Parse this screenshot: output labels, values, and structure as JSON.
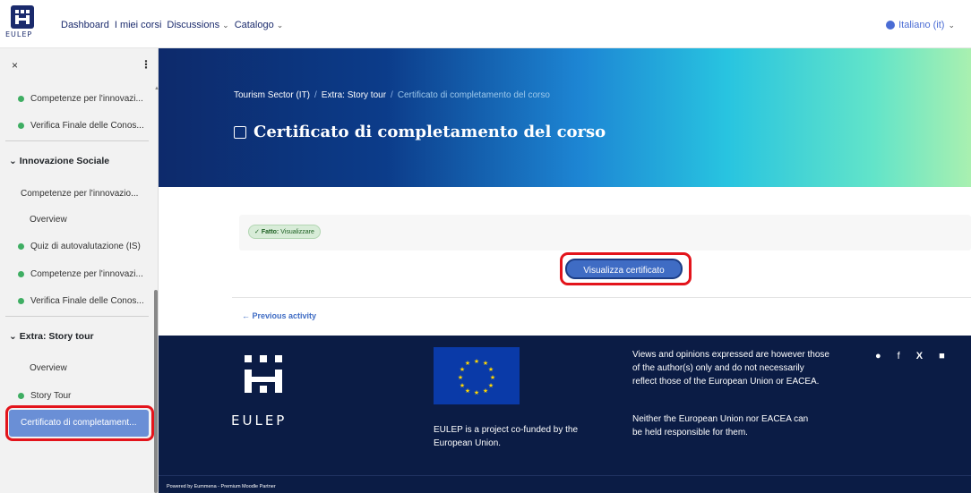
{
  "navbar": {
    "logo_text": "EULEP",
    "items": [
      {
        "label": "Dashboard",
        "dropdown": false
      },
      {
        "label": "I miei corsi",
        "dropdown": false
      },
      {
        "label": "Discussions",
        "dropdown": true
      },
      {
        "label": "Catalogo",
        "dropdown": true
      }
    ],
    "language": "Italiano (it)"
  },
  "sidebar": {
    "close_icon": "×",
    "menu_icon": "⋮",
    "items": [
      {
        "label": "Competenze per l'innovazi...",
        "done": true
      },
      {
        "label": "Verifica Finale delle Conos...",
        "done": true
      }
    ],
    "sections": [
      {
        "title": "Innovazione Sociale",
        "items": [
          {
            "label": "Competenze per l'innovazio...",
            "done": false
          },
          {
            "label": "Overview",
            "done": false
          },
          {
            "label": "Quiz di autovalutazione (IS)",
            "done": true
          },
          {
            "label": "Competenze per l'innovazi...",
            "done": true
          },
          {
            "label": "Verifica Finale delle Conos...",
            "done": true
          }
        ]
      },
      {
        "title": "Extra: Story tour",
        "items": [
          {
            "label": "Overview",
            "done": false
          },
          {
            "label": "Story Tour",
            "done": true
          },
          {
            "label": "Certificato di completament...",
            "done": false,
            "active": true
          }
        ]
      }
    ]
  },
  "hero": {
    "breadcrumb": [
      "Tourism Sector (IT)",
      "Extra: Story tour",
      "Certificato di completamento del corso"
    ],
    "title": "Certificato di completamento del corso"
  },
  "main": {
    "status_prefix": "Fatto:",
    "status_text": "Visualizzare",
    "view_button": "Visualizza certificato",
    "prev_link": "← Previous activity"
  },
  "footer": {
    "logo_text": "EULEP",
    "eu_caption": "EULEP is a project co-funded by the European Union.",
    "disclaimer_1": "Views and opinions expressed are however those of the author(s) only and do not necessarily reflect those of the European Union or EACEA.",
    "disclaimer_2": "Neither the European Union nor EACEA can be held responsible for them.",
    "social_icons": [
      "globe-icon",
      "facebook-icon",
      "x-icon",
      "linkedin-icon"
    ],
    "powered_by": "Powered by Eummena - Premium Moodle Partner"
  },
  "colors": {
    "brand_navy": "#1a2a6c",
    "accent_blue": "#3f6cc4",
    "highlight_red": "#e3141b",
    "done_green": "#3fae63"
  }
}
